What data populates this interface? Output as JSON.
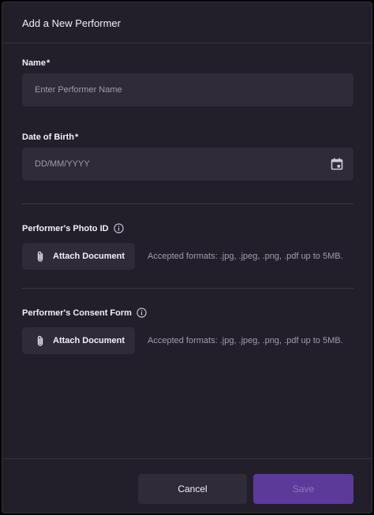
{
  "dialog": {
    "title": "Add a New Performer"
  },
  "fields": {
    "name": {
      "label": "Name",
      "required_mark": "*",
      "placeholder": "Enter Performer Name",
      "value": ""
    },
    "dob": {
      "label": "Date of Birth",
      "required_mark": "*",
      "placeholder": "DD/MM/YYYY",
      "value": "",
      "icon": "calendar-icon"
    }
  },
  "uploads": {
    "photo_id": {
      "label": "Performer's Photo ID",
      "info_icon": "info-icon",
      "button_label": "Attach Document",
      "button_icon": "paperclip-icon",
      "hint": "Accepted formats: .jpg, .jpeg, .png, .pdf up to 5MB."
    },
    "consent_form": {
      "label": "Performer's Consent Form",
      "info_icon": "info-icon",
      "button_label": "Attach Document",
      "button_icon": "paperclip-icon",
      "hint": "Accepted formats: .jpg, .jpeg, .png, .pdf up to 5MB."
    }
  },
  "footer": {
    "cancel_label": "Cancel",
    "save_label": "Save",
    "save_disabled": true
  },
  "colors": {
    "background": "#221f2a",
    "input_background": "#2f2b38",
    "accent": "#5b3a9a",
    "text_primary": "#f2f0f6",
    "text_muted": "#a19cab"
  }
}
